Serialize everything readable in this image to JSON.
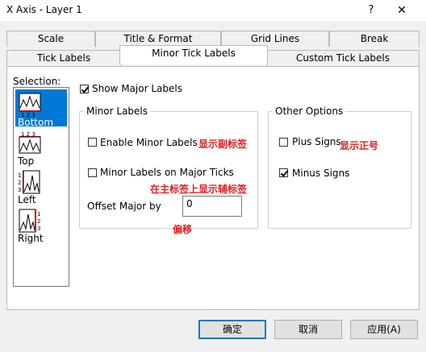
{
  "window": {
    "title": "X Axis - Layer 1",
    "help": "?",
    "close": "✕"
  },
  "tabs_row1": [
    "Scale",
    "Title & Format",
    "Grid Lines",
    "Break"
  ],
  "tabs_row2": [
    "Tick Labels",
    "Minor Tick Labels",
    "Custom Tick Labels"
  ],
  "active_tab": "Minor Tick Labels",
  "selection": {
    "label": "Selection:",
    "items": [
      "Bottom",
      "Top",
      "Left",
      "Right"
    ],
    "selected": "Bottom"
  },
  "show_major_labels": {
    "label": "Show Major Labels",
    "checked": true
  },
  "minor_labels": {
    "title": "Minor Labels",
    "enable": {
      "label": "Enable Minor Labels",
      "checked": false,
      "annotation": "显示副标签"
    },
    "on_major_ticks": {
      "label": "Minor Labels on Major Ticks",
      "checked": false,
      "annotation": "在主标签上显示辅标签"
    },
    "offset": {
      "label": "Offset Major by",
      "value": "0",
      "annotation": "偏移"
    }
  },
  "other_options": {
    "title": "Other Options",
    "plus_signs": {
      "label": "Plus Signs",
      "checked": false,
      "annotation": "显示正号"
    },
    "minus_signs": {
      "label": "Minus Signs",
      "checked": true
    }
  },
  "buttons": {
    "ok": "确定",
    "cancel": "取消",
    "apply": "应用(A)"
  }
}
